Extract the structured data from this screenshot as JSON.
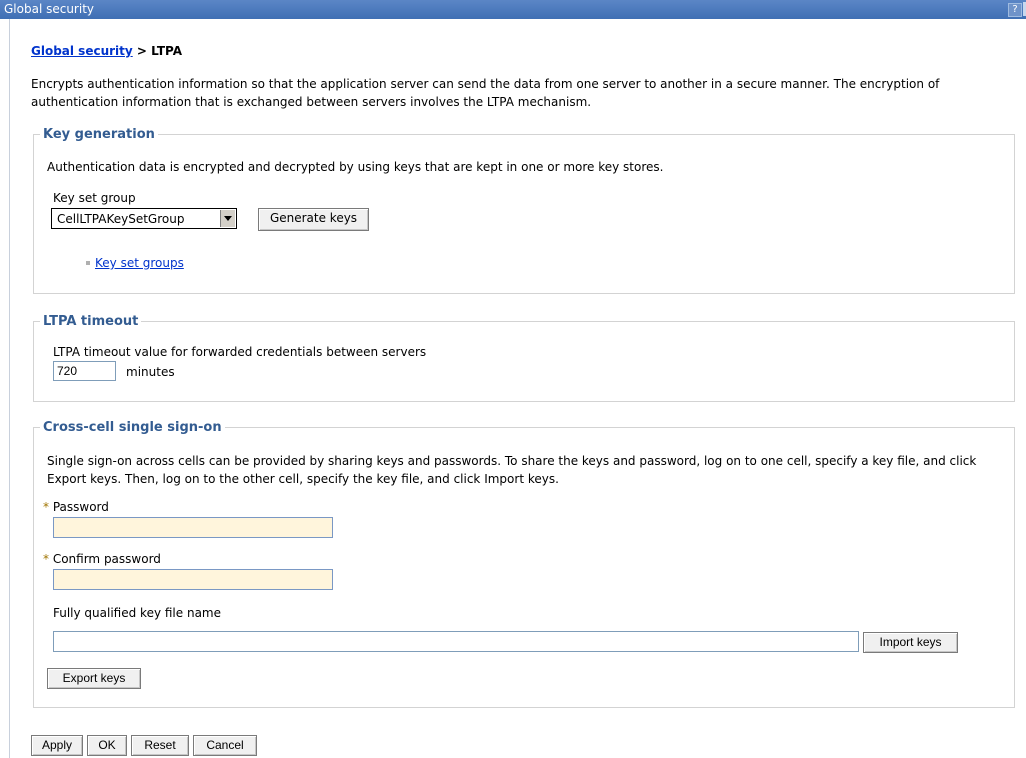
{
  "window": {
    "title": "Global security",
    "help_glyph": "?"
  },
  "breadcrumb": {
    "parent": "Global security",
    "separator": ">",
    "current": "LTPA"
  },
  "description": "Encrypts authentication information so that the application server can send the data from one server to another in a secure manner. The encryption of authentication information that is exchanged between servers involves the LTPA mechanism.",
  "key_generation": {
    "legend": "Key generation",
    "text": "Authentication data is encrypted and decrypted by using keys that are kept in one or more key stores.",
    "key_set_group_label": "Key set group",
    "key_set_group_value": "CellLTPAKeySetGroup",
    "generate_button": "Generate keys",
    "key_set_groups_link": "Key set groups"
  },
  "ltpa_timeout": {
    "legend": "LTPA timeout",
    "label": "LTPA timeout value for forwarded credentials between servers",
    "value": "720",
    "unit": "minutes"
  },
  "cross_cell": {
    "legend": "Cross-cell single sign-on",
    "text": "Single sign-on across cells can be provided by sharing keys and passwords. To share the keys and password, log on to one cell, specify a key file, and click Export keys. Then, log on to the other cell, specify the key file, and click Import keys.",
    "required_marker": "*",
    "password_label": "Password",
    "password_value": "",
    "confirm_label": "Confirm password",
    "confirm_value": "",
    "key_file_label": "Fully qualified key file name",
    "key_file_value": "",
    "import_button": "Import keys",
    "export_button": "Export keys"
  },
  "actions": {
    "apply": "Apply",
    "ok": "OK",
    "reset": "Reset",
    "cancel": "Cancel"
  }
}
